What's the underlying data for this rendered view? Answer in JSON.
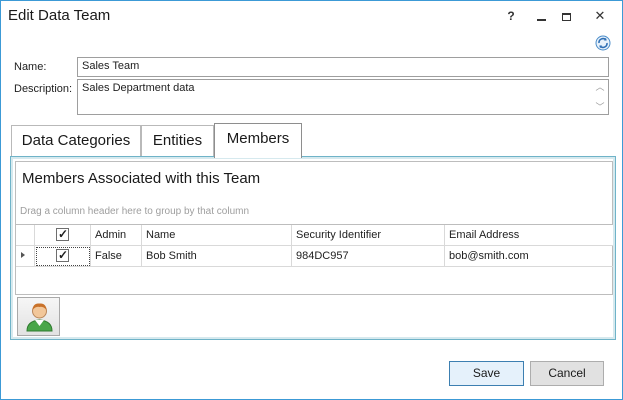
{
  "window": {
    "title": "Edit Data Team",
    "help_glyph": "?",
    "close_glyph": "✕"
  },
  "form": {
    "name_label": "Name:",
    "name_value": "Sales Team",
    "description_label": "Description:",
    "description_value": "Sales Department data"
  },
  "tabs": [
    {
      "label": "Data Categories",
      "active": false
    },
    {
      "label": "Entities",
      "active": false
    },
    {
      "label": "Members",
      "active": true
    }
  ],
  "members": {
    "section_title": "Members Associated with this Team",
    "group_hint": "Drag a column header here to group by that column",
    "columns": [
      "Admin",
      "Name",
      "Security Identifier",
      "Email Address"
    ],
    "select_all_checked": true,
    "rows": [
      {
        "selected": true,
        "admin": "False",
        "name": "Bob Smith",
        "security_identifier": "984DC957",
        "email": "bob@smith.com"
      }
    ]
  },
  "icons": {
    "refresh": "refresh-icon",
    "add_member": "user-add-icon"
  },
  "buttons": {
    "save": "Save",
    "cancel": "Cancel"
  },
  "colors": {
    "window_border": "#3c9ad6",
    "panel_border": "#6fb3c8",
    "primary_button_border": "#3c7fb1"
  }
}
